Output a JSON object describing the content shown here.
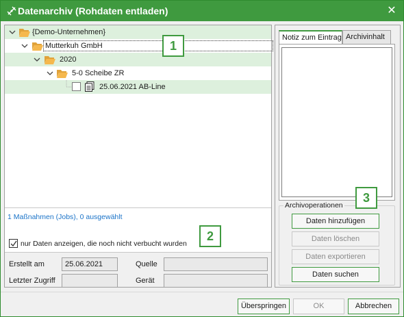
{
  "window": {
    "title": "Datenarchiv (Rohdaten entladen)",
    "close_glyph": "✕"
  },
  "tree": {
    "nodes": [
      {
        "label": "{Demo-Unternehmen}",
        "level": 0,
        "expanded": true,
        "highlighted": true
      },
      {
        "label": "Mutterkuh GmbH",
        "level": 1,
        "expanded": true,
        "highlighted": false,
        "focused": true
      },
      {
        "label": "2020",
        "level": 2,
        "expanded": true,
        "highlighted": true
      },
      {
        "label": "5-0 Scheibe ZR",
        "level": 3,
        "expanded": true,
        "highlighted": false
      },
      {
        "label": "25.06.2021 AB-Line",
        "level": 4,
        "highlighted": true,
        "checked": false
      }
    ]
  },
  "status": {
    "text": "1 Maßnahmen (Jobs), 0 ausgewählt"
  },
  "filter": {
    "label": "nur Daten anzeigen, die noch nicht verbucht wurden",
    "checked": true
  },
  "meta": {
    "created_label": "Erstellt am",
    "created_value": "25.06.2021",
    "last_access_label": "Letzter Zugriff",
    "last_access_value": "",
    "source_label": "Quelle",
    "source_value": "",
    "device_label": "Gerät",
    "device_value": ""
  },
  "tabs": [
    {
      "label": "Notiz zum Eintrag",
      "active": true
    },
    {
      "label": "Archivinhalt",
      "active": false
    }
  ],
  "operations": {
    "title": "Archivoperationen",
    "buttons": [
      {
        "label": "Daten hinzufügen",
        "enabled": true
      },
      {
        "label": "Daten löschen",
        "enabled": false
      },
      {
        "label": "Daten exportieren",
        "enabled": false
      },
      {
        "label": "Daten suchen",
        "enabled": true
      }
    ]
  },
  "dialog_buttons": {
    "skip": "Überspringen",
    "ok": "OK",
    "cancel": "Abbrechen"
  },
  "callouts": {
    "one": "1",
    "two": "2",
    "three": "3"
  },
  "colors": {
    "accent": "#3f9a3f",
    "highlight_row": "#ddf0dd",
    "link_blue": "#1a73c8",
    "folder": "#f5b84d"
  }
}
